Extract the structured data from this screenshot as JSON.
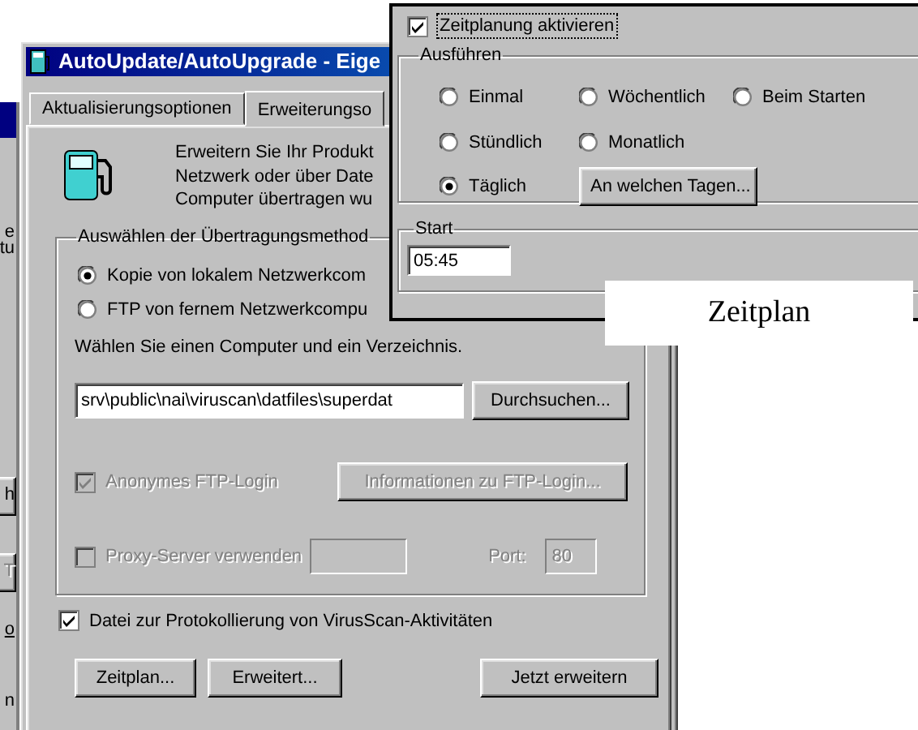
{
  "back_window": {
    "fragments": [
      {
        "text": "e",
        "kind": "text"
      },
      {
        "text": "tu",
        "kind": "text"
      },
      {
        "text": "h",
        "kind": "button"
      },
      {
        "text": "T",
        "kind": "disabled_button"
      },
      {
        "text": "o",
        "kind": "link"
      },
      {
        "text": "n",
        "kind": "text"
      }
    ]
  },
  "main_window": {
    "title": "AutoUpdate/AutoUpgrade - Eige",
    "tabs": [
      {
        "label": "Aktualisierungsoptionen",
        "selected": false
      },
      {
        "label": "Erweiterungso",
        "selected": true
      }
    ],
    "intro_lines": [
      "Erweitern Sie Ihr Produkt",
      "Netzwerk oder über Date",
      "Computer übertragen wu"
    ],
    "method_group": {
      "title": "Auswählen der Übertragungsmethod",
      "options": [
        {
          "label": "Kopie von lokalem Netzwerkcom",
          "selected": true
        },
        {
          "label": "FTP von fernem Netzwerkcompu",
          "selected": false
        }
      ],
      "prompt": "Wählen Sie einen Computer und ein Verzeichnis.",
      "path_value": "srv\\public\\nai\\viruscan\\datfiles\\superdat",
      "browse_button": {
        "label": "Durchsuchen..."
      },
      "anonymous_ftp": {
        "label": "Anonymes FTP-Login",
        "checked": true,
        "disabled": true
      },
      "ftp_info_button": {
        "label": "Informationen zu FTP-Login...",
        "disabled": true
      },
      "proxy": {
        "label": "Proxy-Server verwenden",
        "checked": false,
        "disabled": true
      },
      "port_label": {
        "label": "Port:"
      },
      "port_value": "80"
    },
    "log_checkbox": {
      "label": "Datei zur Protokollierung von VirusScan-Aktivitäten",
      "checked": true
    },
    "buttons": [
      {
        "label": "Zeitplan..."
      },
      {
        "label": "Erweitert..."
      },
      {
        "label": "Jetzt erweitern"
      }
    ]
  },
  "schedule_window": {
    "enable": {
      "label": "Zeitplanung aktivieren",
      "checked": true
    },
    "run_group": {
      "title": "Ausführen",
      "rows": [
        [
          {
            "label": "Einmal",
            "selected": false
          },
          {
            "label": "Wöchentlich",
            "selected": false
          },
          {
            "label": "Beim Starten",
            "selected": false
          }
        ],
        [
          {
            "label": "Stündlich",
            "selected": false
          },
          {
            "label": "Monatlich",
            "selected": false
          }
        ],
        [
          {
            "label": "Täglich",
            "selected": true
          }
        ]
      ],
      "days_button": {
        "label": "An welchen Tagen..."
      }
    },
    "start_group": {
      "title": "Start",
      "value": "05:45"
    }
  },
  "caption": "Zeitplan"
}
